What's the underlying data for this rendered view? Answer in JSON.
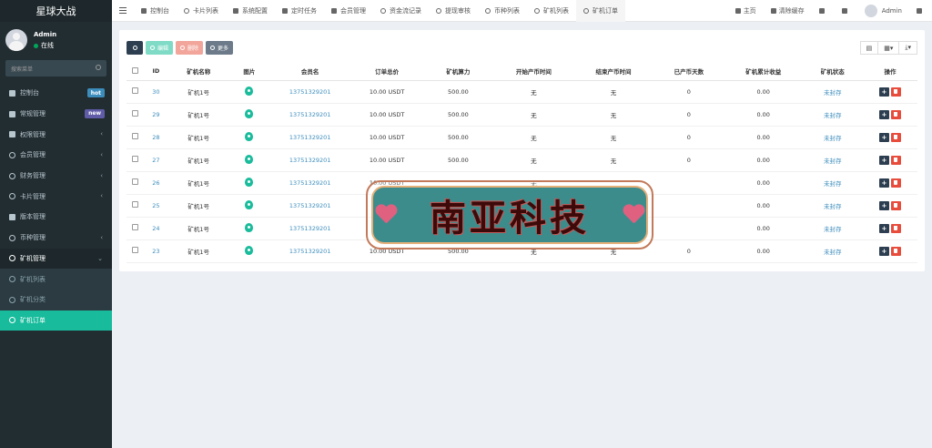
{
  "brand": "星球大战",
  "user": {
    "name": "Admin",
    "status": "在线"
  },
  "search": {
    "placeholder": "搜索菜单"
  },
  "sidebar": {
    "items": [
      {
        "label": "控制台",
        "badge": "hot"
      },
      {
        "label": "常规管理",
        "badge": "new"
      },
      {
        "label": "权限管理",
        "arrow": "‹"
      },
      {
        "label": "会员管理",
        "arrow": "‹"
      },
      {
        "label": "财务管理",
        "arrow": "‹"
      },
      {
        "label": "卡片管理",
        "arrow": "‹"
      },
      {
        "label": "版本管理"
      },
      {
        "label": "币种管理",
        "arrow": "‹"
      },
      {
        "label": "矿机管理",
        "arrow": "⌄"
      }
    ],
    "submenu": [
      {
        "label": "矿机列表"
      },
      {
        "label": "矿机分类"
      },
      {
        "label": "矿机订单"
      }
    ]
  },
  "tabs": [
    "控制台",
    "卡片列表",
    "系统配置",
    "定时任务",
    "会员管理",
    "资金流记录",
    "提现审核",
    "币种列表",
    "矿机列表",
    "矿机订单"
  ],
  "topright": {
    "home": "主页",
    "clear_cache": "清除缓存",
    "user": "Admin"
  },
  "toolbar": {
    "edit": "编辑",
    "delete": "删除",
    "more": "更多"
  },
  "table": {
    "headers": [
      "ID",
      "矿机名称",
      "图片",
      "会员名",
      "订单总价",
      "矿机算力",
      "开始产币时间",
      "结束产币时间",
      "已产币天数",
      "矿机累计收益",
      "矿机状态",
      "操作"
    ],
    "rows": [
      {
        "id": "30",
        "name": "矿机1号",
        "member": "13751329201",
        "price": "10.00 USDT",
        "power": "500.00",
        "start": "无",
        "end": "无",
        "days": "0",
        "income": "0.00",
        "status": "未封存"
      },
      {
        "id": "29",
        "name": "矿机1号",
        "member": "13751329201",
        "price": "10.00 USDT",
        "power": "500.00",
        "start": "无",
        "end": "无",
        "days": "0",
        "income": "0.00",
        "status": "未封存"
      },
      {
        "id": "28",
        "name": "矿机1号",
        "member": "13751329201",
        "price": "10.00 USDT",
        "power": "500.00",
        "start": "无",
        "end": "无",
        "days": "0",
        "income": "0.00",
        "status": "未封存"
      },
      {
        "id": "27",
        "name": "矿机1号",
        "member": "13751329201",
        "price": "10.00 USDT",
        "power": "500.00",
        "start": "无",
        "end": "无",
        "days": "0",
        "income": "0.00",
        "status": "未封存"
      },
      {
        "id": "26",
        "name": "矿机1号",
        "member": "13751329201",
        "price": "10.00 USDT",
        "power": "",
        "start": "无",
        "end": "",
        "days": "",
        "income": "0.00",
        "status": "未封存"
      },
      {
        "id": "25",
        "name": "矿机1号",
        "member": "13751329201",
        "price": "",
        "power": "",
        "start": "",
        "end": "",
        "days": "",
        "income": "0.00",
        "status": "未封存"
      },
      {
        "id": "24",
        "name": "矿机1号",
        "member": "13751329201",
        "price": "",
        "power": "",
        "start": "",
        "end": "",
        "days": "",
        "income": "0.00",
        "status": "未封存"
      },
      {
        "id": "23",
        "name": "矿机1号",
        "member": "13751329201",
        "price": "10.00 USDT",
        "power": "500.00",
        "start": "无",
        "end": "无",
        "days": "0",
        "income": "0.00",
        "status": "未封存"
      }
    ]
  },
  "watermark": "南亚科技"
}
